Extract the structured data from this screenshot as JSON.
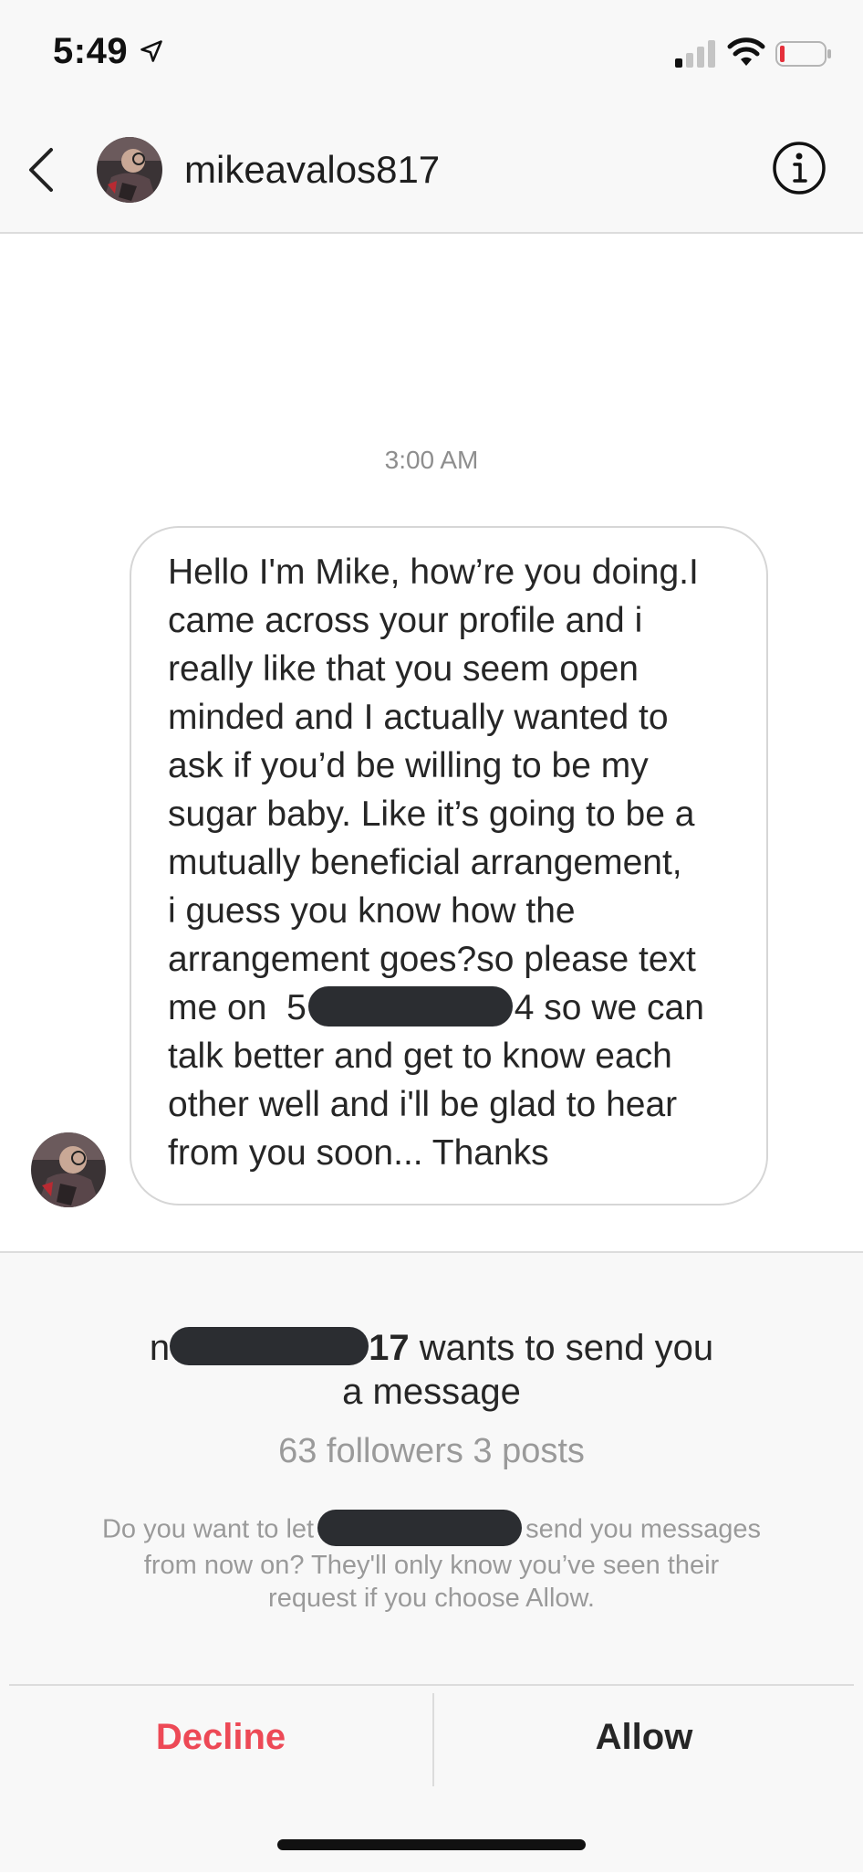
{
  "status_bar": {
    "time": "5:49",
    "icons": [
      "location-arrow-icon",
      "signal-icon",
      "wifi-icon",
      "battery-icon"
    ]
  },
  "header": {
    "username": "mikeavalos817",
    "icons": [
      "back-chevron-icon",
      "avatar",
      "info-icon"
    ]
  },
  "chat": {
    "timestamp": "3:00 AM",
    "message": {
      "line_1": "Hello I'm Mike, how’re you doing.I",
      "line_2": "came across your profile and i",
      "line_3": "really like that you seem open",
      "line_4": "minded and I actually wanted to",
      "line_5": "ask if you’d be willing to be my",
      "line_6": "sugar baby. Like it’s going to be a",
      "line_7": "mutually beneficial arrangement,",
      "line_8": "i guess you know how the",
      "line_9": "arrangement goes?so please text",
      "line_10_start": "me on  5",
      "line_10_end": "4 so we can",
      "line_11": "talk better and get to know each",
      "line_12": "other well and i'll be glad to hear",
      "line_13": "from you soon... Thanks"
    }
  },
  "request": {
    "title_prefix": "n",
    "title_suffix": "17",
    "title_rest": " wants to send you",
    "title_line2": "a message",
    "stats": "63 followers 3 posts",
    "note_part1": "Do you want to let",
    "note_part2": "send you messages",
    "note_line2": "from now on? They'll only know you’ve seen their",
    "note_line3": "request if you choose Allow."
  },
  "actions": {
    "decline_label": "Decline",
    "allow_label": "Allow"
  },
  "colors": {
    "decline": "#ed4956",
    "redaction": "#2b2d31",
    "panel_background": "#f8f8f8"
  }
}
